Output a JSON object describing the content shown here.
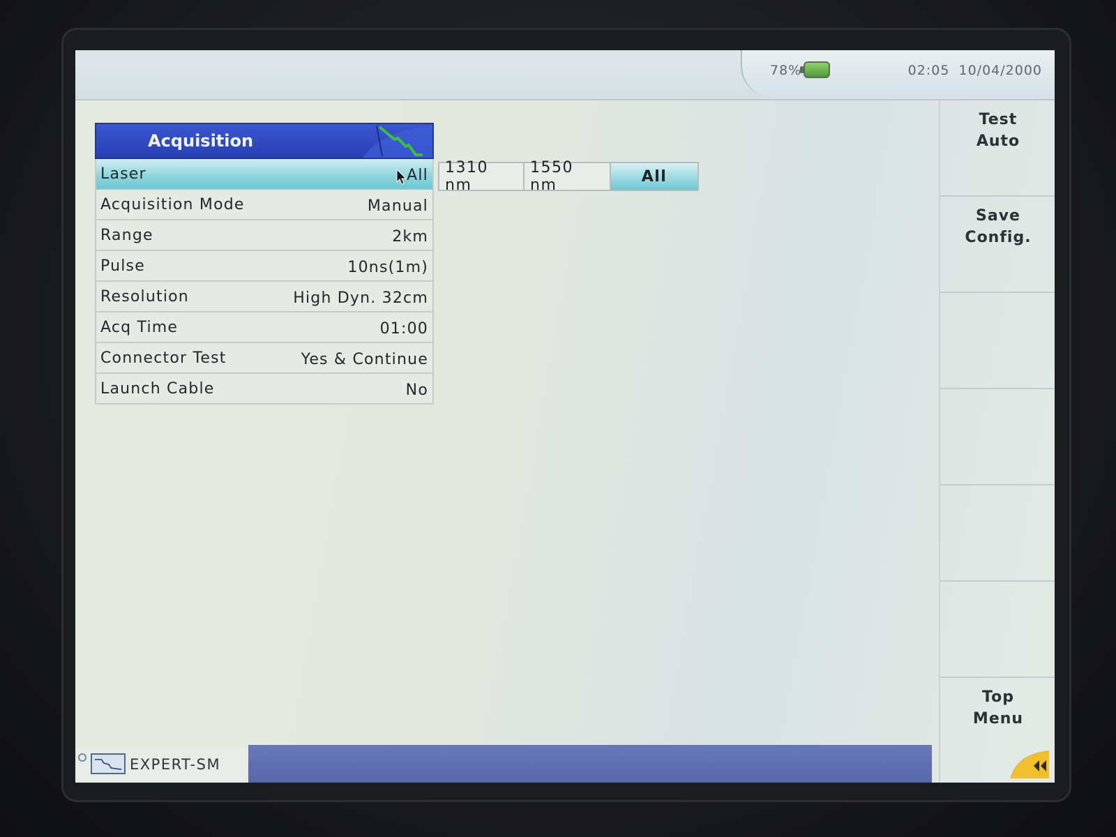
{
  "status": {
    "battery_percent": "78%",
    "time": "02:05",
    "date": "10/04/2000"
  },
  "panel": {
    "title": "Acquisition",
    "rows": [
      {
        "label": "Laser",
        "value": "All"
      },
      {
        "label": "Acquisition Mode",
        "value": "Manual"
      },
      {
        "label": "Range",
        "value": "2km"
      },
      {
        "label": "Pulse",
        "value": "10ns(1m)"
      },
      {
        "label": "Resolution",
        "value": "High Dyn. 32cm"
      },
      {
        "label": "Acq Time",
        "value": "01:00"
      },
      {
        "label": "Connector Test",
        "value": "Yes & Continue"
      },
      {
        "label": "Launch Cable",
        "value": "No"
      }
    ]
  },
  "laser_options": [
    "1310 nm",
    "1550 nm",
    "All"
  ],
  "softkeys": {
    "test_auto": [
      "Test",
      "Auto"
    ],
    "save_config": [
      "Save",
      "Config."
    ],
    "top_menu": [
      "Top",
      "Menu"
    ]
  },
  "taskbar": {
    "app_label": "EXPERT-SM"
  },
  "colors": {
    "header_blue": "#2f4bc4",
    "selection_cyan": "#7fd0da",
    "taskbar_blue": "#5f6fb2",
    "corner_yellow": "#f2c230"
  }
}
